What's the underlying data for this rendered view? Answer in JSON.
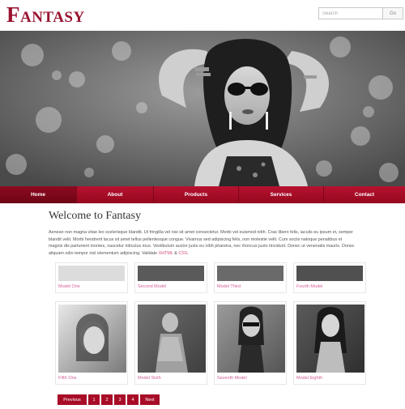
{
  "site": {
    "logo": "Fantasy"
  },
  "search": {
    "placeholder": "Search",
    "button_label": "Go"
  },
  "nav": {
    "items": [
      {
        "label": "Home",
        "active": true
      },
      {
        "label": "About",
        "active": false
      },
      {
        "label": "Products",
        "active": false
      },
      {
        "label": "Services",
        "active": false
      },
      {
        "label": "Contact",
        "active": false
      }
    ]
  },
  "main": {
    "title": "Welcome to Fantasy",
    "intro_text": "Aenean non magna vitae leo scelerisque blandit. Ut fringilla vel nisi sit amet consectetur. Morbi vel euismod nibh. Cras libero felis, iaculis eu ipsum et, semper blandit velit. Morbi hendrerit lacus sit amet tellus pellentesque congue. Vivamus sed adipiscing felis, non molestie velit. Cum sociis natoque penatibus et magnis dis parturient montes, nascetur ridiculus mus. Vestibulum auctor justo eu nibh pharetra, nec rhoncus justo tincidunt. Donec ut venenatis mauris. Donec aliquam odio tempor nisl elementum adipiscing. Validate",
    "link_xhtml": "XHTML",
    "link_and": "&",
    "link_css": "CSS",
    "link_end": "."
  },
  "gallery": {
    "row1": [
      "Model One",
      "Second Model",
      "Model Third",
      "Fourth Model"
    ],
    "row2": [
      "Fifth One",
      "Model Sixth",
      "Seventh Model",
      "Model Eighth"
    ]
  },
  "pagination": {
    "previous": "Previous",
    "pages": [
      "1",
      "2",
      "3",
      "4"
    ],
    "next": "Next"
  },
  "colors": {
    "brand": "#9a1330",
    "nav": "#a80d28",
    "link": "#d45e9a"
  }
}
